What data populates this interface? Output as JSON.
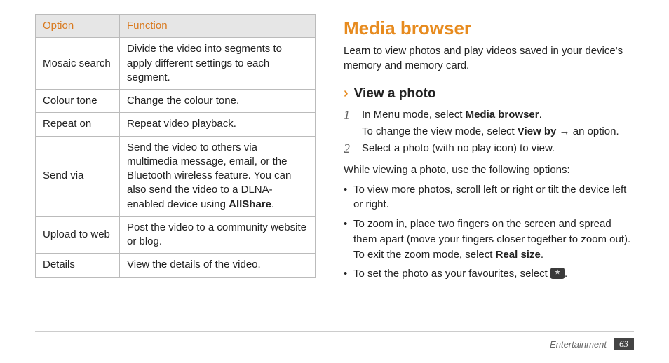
{
  "table": {
    "headers": {
      "option": "Option",
      "function": "Function"
    },
    "rows": [
      {
        "option": "Mosaic search",
        "function": "Divide the video into segments to apply different settings to each segment."
      },
      {
        "option": "Colour tone",
        "function": "Change the colour tone."
      },
      {
        "option": "Repeat on",
        "function": "Repeat video playback."
      },
      {
        "option": "Send via",
        "function_pre": "Send the video to others via multimedia message, email, or the Bluetooth wireless feature. You can also send the video to a DLNA-enabled device using ",
        "function_bold": "AllShare",
        "function_post": "."
      },
      {
        "option": "Upload to web",
        "function": "Post the video to a community website or blog."
      },
      {
        "option": "Details",
        "function": "View the details of the video."
      }
    ]
  },
  "right": {
    "title": "Media browser",
    "intro": "Learn to view photos and play videos saved in your device's memory and memory card.",
    "sub_title": "View a photo",
    "steps": {
      "s1_a": "In Menu mode, select ",
      "s1_bold": "Media browser",
      "s1_b": ".",
      "s1_line2_a": "To change the view mode, select ",
      "s1_line2_bold": "View by",
      "s1_line2_b": " → an option.",
      "s2": "Select a photo (with no play icon) to view."
    },
    "while_text": "While viewing a photo, use the following options:",
    "bullets": {
      "b1": "To view more photos, scroll left or right or tilt the device left or right.",
      "b2_a": "To zoom in, place two fingers on the screen and spread them apart (move your fingers closer together to zoom out). To exit the zoom mode, select ",
      "b2_bold": "Real size",
      "b2_b": ".",
      "b3_a": "To set the photo as your favourites, select ",
      "b3_b": "."
    }
  },
  "footer": {
    "category": "Entertainment",
    "page": "63"
  }
}
